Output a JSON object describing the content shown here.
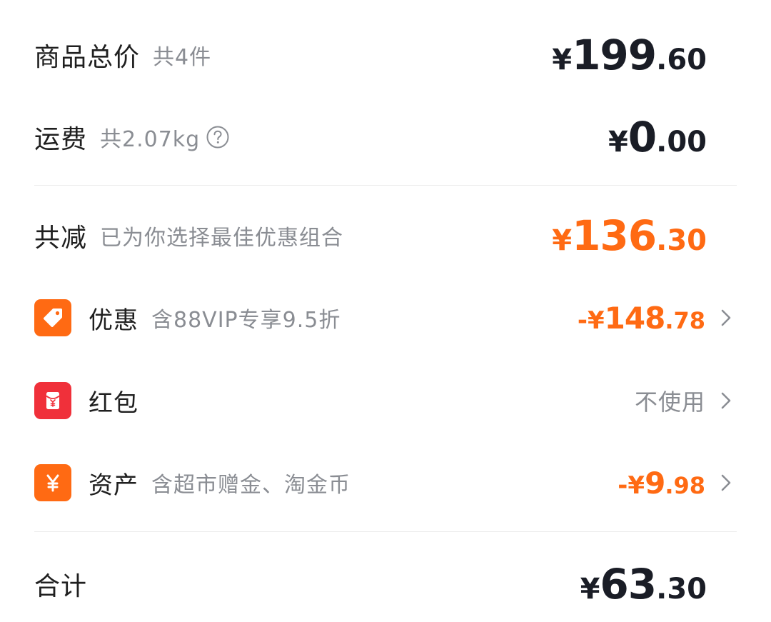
{
  "subtotal": {
    "label": "商品总价",
    "sub": "共4件",
    "symbol": "¥",
    "integer": "199",
    "decimal": ".60"
  },
  "shipping": {
    "label": "运费",
    "sub": "共2.07kg",
    "help_icon": "question-circle-icon",
    "symbol": "¥",
    "integer": "0",
    "decimal": ".00"
  },
  "total_discount": {
    "label": "共减",
    "sub": "已为你选择最佳优惠组合",
    "symbol": "¥",
    "integer": "136",
    "decimal": ".30"
  },
  "promotion": {
    "icon": "tag-icon",
    "label": "优惠",
    "sub": "含88VIP专享9.5折",
    "symbol": "-¥",
    "integer": "148",
    "decimal": ".78"
  },
  "red_packet": {
    "icon": "red-packet-icon",
    "label": "红包",
    "value": "不使用"
  },
  "assets": {
    "icon": "yuan-icon",
    "label": "资产",
    "sub": "含超市赠金、淘金币",
    "symbol": "-¥",
    "integer": "9",
    "decimal": ".98"
  },
  "grand_total": {
    "label": "合计",
    "symbol": "¥",
    "integer": "63",
    "decimal": ".30"
  },
  "colors": {
    "accent_orange": "#ff6a13",
    "red_icon": "#f0303a",
    "text_dark": "#1a1d26",
    "text_muted": "#8a8d93"
  }
}
